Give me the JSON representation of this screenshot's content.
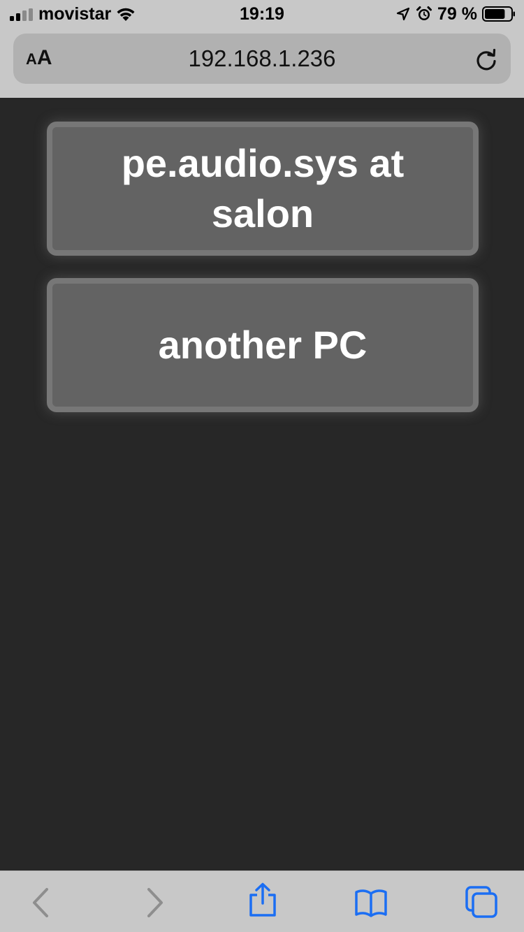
{
  "status_bar": {
    "carrier": "movistar",
    "time": "19:19",
    "battery_percent": "79 %",
    "battery_level": 0.79,
    "icons": [
      "signal-icon",
      "wifi-icon",
      "location-icon",
      "alarm-icon",
      "battery-icon"
    ]
  },
  "address_bar": {
    "text_size_small": "A",
    "text_size_big": "A",
    "url": "192.168.1.236",
    "reload_icon": "reload-icon"
  },
  "hosts": [
    {
      "label": "pe.audio.sys at salon"
    },
    {
      "label": "another PC"
    }
  ],
  "bottom_toolbar": {
    "icons": [
      "back-icon",
      "forward-icon",
      "share-icon",
      "bookmarks-icon",
      "tabs-icon"
    ],
    "accent_color": "#1b6ef3",
    "disabled_color": "#8e8e8e"
  },
  "colors": {
    "page_background": "#272727",
    "button_fill": "#636363",
    "button_border": "#777777",
    "chrome_background": "#c8c8c8"
  }
}
